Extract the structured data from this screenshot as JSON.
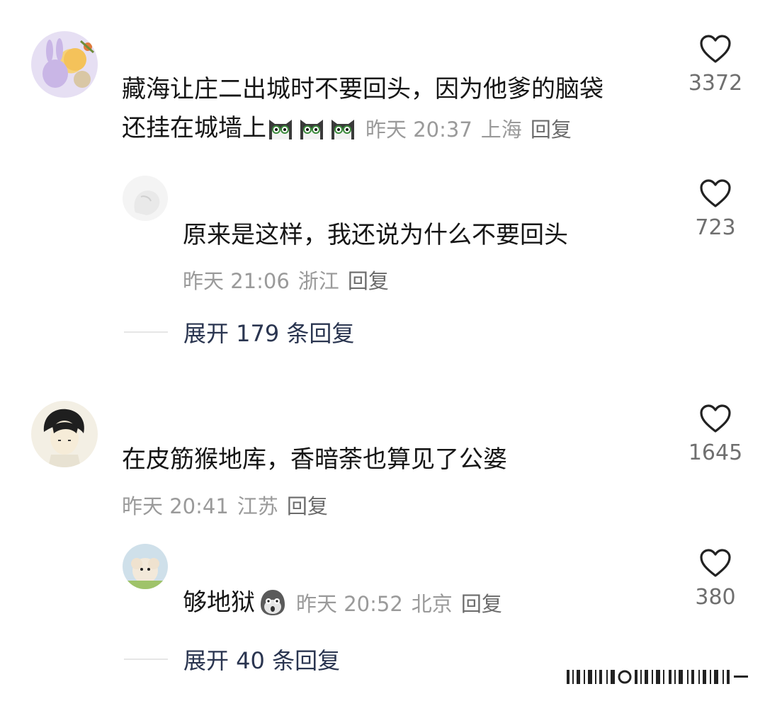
{
  "comments": [
    {
      "text_line1": "藏海让庄二出城时不要回头，因为他爹的脑袋",
      "text_line2": "还挂在城墙上",
      "time": "昨天 20:37",
      "location": "上海",
      "reply_label": "回复",
      "likes": "3372",
      "emoji": "cat-face-icon",
      "reply": {
        "text": "原来是这样，我还说为什么不要回头",
        "time": "昨天 21:06",
        "location": "浙江",
        "reply_label": "回复",
        "likes": "723"
      },
      "expand_label": "展开 179 条回复"
    },
    {
      "text": "在皮筋猴地库，香暗荼也算见了公婆",
      "time": "昨天 20:41",
      "location": "江苏",
      "reply_label": "回复",
      "likes": "1645",
      "reply": {
        "text": "够地狱",
        "emoji": "shocked-face-icon",
        "time": "昨天 20:52",
        "location": "北京",
        "reply_label": "回复",
        "likes": "380"
      },
      "expand_label": "展开 40 条回复"
    }
  ],
  "colors": {
    "heart": "#222222",
    "meta": "#9a9a9a",
    "expand": "#2a3550"
  }
}
